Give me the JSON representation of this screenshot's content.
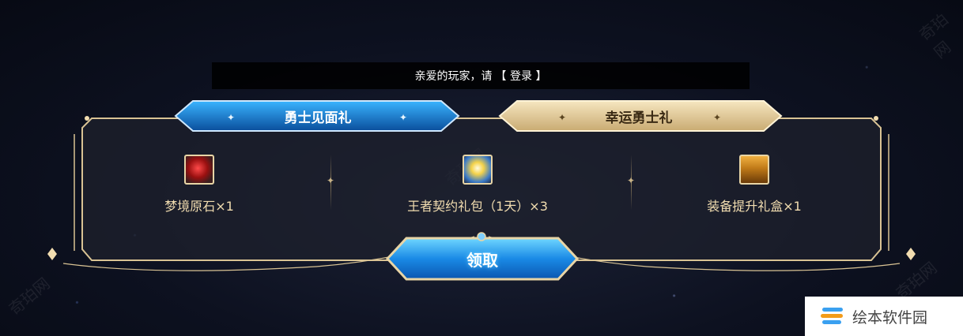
{
  "login": {
    "prefix": "亲爱的玩家，请",
    "link": "【 登录 】"
  },
  "tabs": [
    {
      "label": "勇士见面礼",
      "active": true
    },
    {
      "label": "幸运勇士礼",
      "active": false
    }
  ],
  "rewards": [
    {
      "name": "梦境原石×1",
      "icon": "red-crystal-icon"
    },
    {
      "name": "王者契约礼包（1天）×3",
      "icon": "contract-gem-icon"
    },
    {
      "name": "装备提升礼盒×1",
      "icon": "treasure-chest-icon"
    }
  ],
  "claim_button": "领取",
  "watermark": "奇珀网",
  "brand": {
    "name": "绘本软件园"
  },
  "colors": {
    "gold": "#e8d5a6",
    "blue": "#1f8fe0",
    "text_gold": "#f2ddb0"
  }
}
